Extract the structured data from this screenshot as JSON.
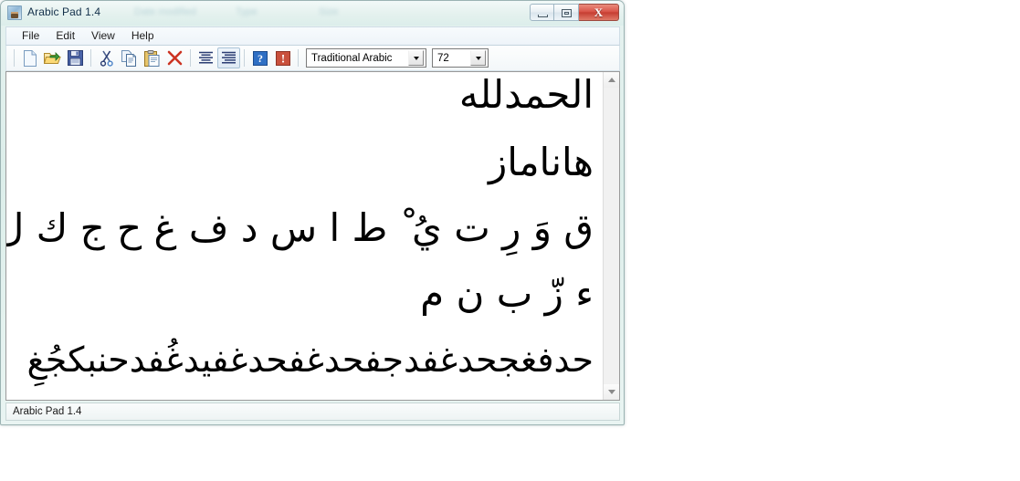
{
  "window": {
    "title": "Arabic Pad 1.4",
    "icon": "app-icon",
    "ghost_artifacts": [
      "Date modified",
      "Type",
      "Size"
    ],
    "controls": {
      "minimize": "minimize",
      "maximize": "maximize",
      "close": "X"
    }
  },
  "menu": {
    "items": [
      {
        "label": "File"
      },
      {
        "label": "Edit"
      },
      {
        "label": "View"
      },
      {
        "label": "Help"
      }
    ]
  },
  "toolbar": {
    "buttons": [
      {
        "name": "new-file-icon",
        "tip": "New"
      },
      {
        "name": "open-folder-icon",
        "tip": "Open"
      },
      {
        "name": "save-disk-icon",
        "tip": "Save"
      },
      {
        "name": "cut-scissors-icon",
        "tip": "Cut"
      },
      {
        "name": "copy-icon",
        "tip": "Copy"
      },
      {
        "name": "paste-clipboard-icon",
        "tip": "Paste"
      },
      {
        "name": "delete-x-icon",
        "tip": "Delete"
      },
      {
        "name": "align-center-icon",
        "tip": "Align center"
      },
      {
        "name": "align-right-icon",
        "tip": "Align right"
      },
      {
        "name": "help-question-icon",
        "tip": "Help"
      },
      {
        "name": "about-exclamation-icon",
        "tip": "About"
      }
    ],
    "font": {
      "value": "Traditional Arabic",
      "options": [
        "Traditional Arabic"
      ]
    },
    "size": {
      "value": "72",
      "options": [
        "72"
      ]
    }
  },
  "editor": {
    "direction": "rtl",
    "alignment": "right",
    "lines": [
      {
        "text": "الحمدلله"
      },
      {
        "text": "هاناماز"
      },
      {
        "text": "ق وَ رِ ت يُ ْ ط ا س د ف غ ح ج ك ل ؛ ع"
      },
      {
        "text": "ء زّ ب ن م"
      },
      {
        "text": "حدفغجحدغفدجفحدغفحدغفيدغُفدحنبكجُغِ"
      }
    ]
  },
  "scrollbar": {
    "up_arrow": "scroll-up",
    "down_arrow": "scroll-down"
  },
  "status": {
    "text": "Arabic Pad 1.4"
  }
}
